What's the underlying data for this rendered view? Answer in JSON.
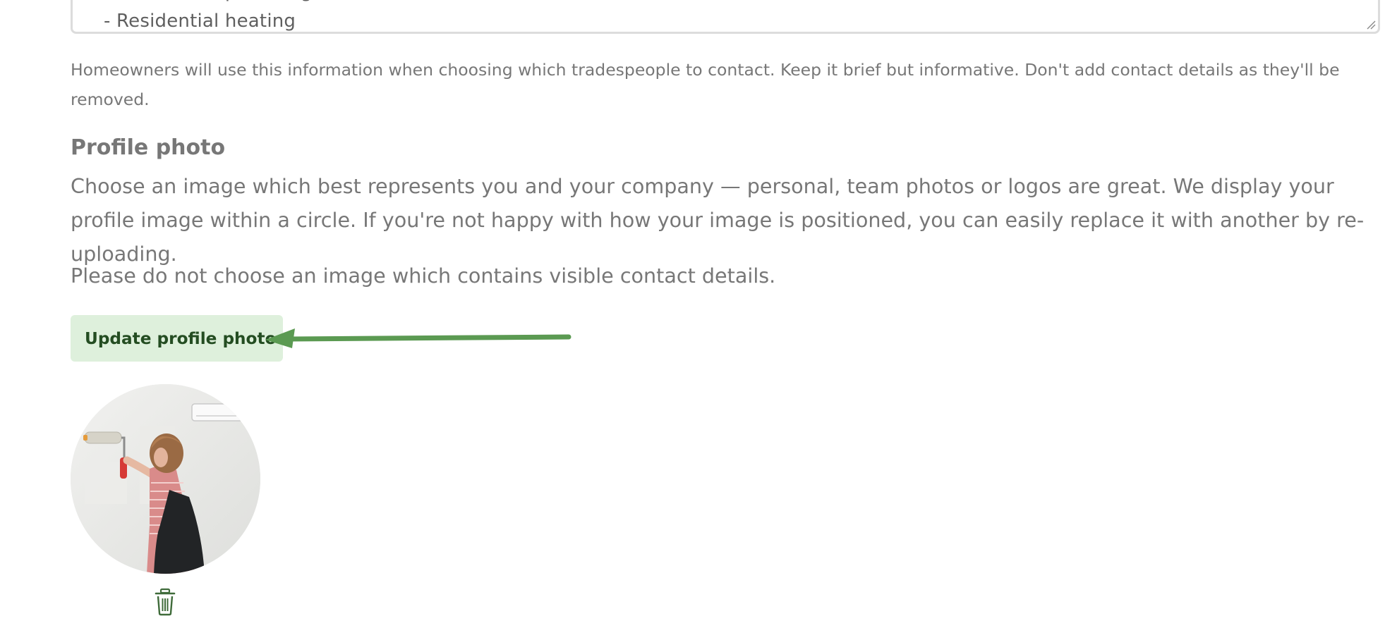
{
  "services": {
    "textarea_visible_text": "- Residential plumbing\n- Residential heating",
    "helper_text": "Homeowners will use this information when choosing which tradespeople to contact. Keep it brief but informative. Don't add contact details as they'll be removed."
  },
  "profile_photo": {
    "heading": "Profile photo",
    "description": "Choose an image which best represents you and your company — personal, team photos or logos are great. We display your profile image within a circle. If you're not happy with how your image is positioned, you can easily replace it with another by re-uploading.",
    "warning": "Please do not choose an image which contains visible contact details.",
    "update_button_label": "Update profile photo",
    "delete_icon": "trash-icon",
    "avatar_alt": "Profile photo"
  },
  "colors": {
    "button_bg": "#def0dc",
    "button_text": "#244d22",
    "annotation_arrow": "#5b9a52",
    "body_text": "#777777"
  }
}
